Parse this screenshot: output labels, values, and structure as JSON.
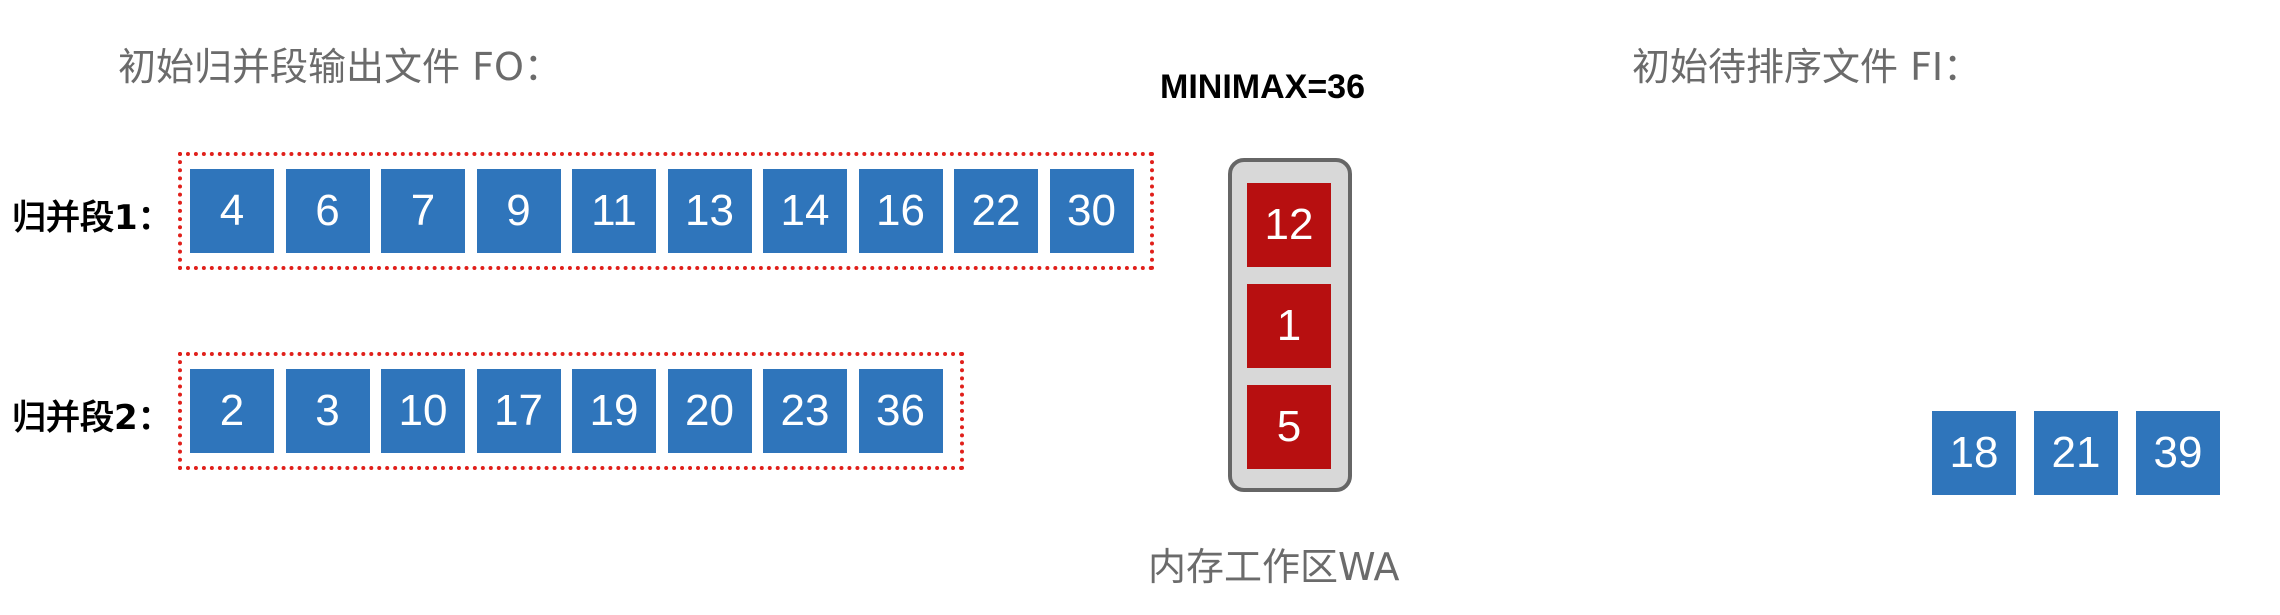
{
  "headings": {
    "output_file": "初始归并段输出文件 FO：",
    "input_file": "初始待排序文件 FI：",
    "minimax": "MINIMAX=36",
    "work_area": "内存工作区WA"
  },
  "runs": [
    {
      "label": "归并段1：",
      "values": [
        "4",
        "6",
        "7",
        "9",
        "11",
        "13",
        "14",
        "16",
        "22",
        "30"
      ]
    },
    {
      "label": "归并段2：",
      "values": [
        "2",
        "3",
        "10",
        "17",
        "19",
        "20",
        "23",
        "36"
      ]
    }
  ],
  "work_area_values": [
    "12",
    "1",
    "5"
  ],
  "input_values": [
    "18",
    "21",
    "39"
  ],
  "colors": {
    "blue_cell": "#2f75bb",
    "red_cell": "#b70f10",
    "dotted_border": "#e0201b",
    "work_area_bg": "#d8d8d8"
  }
}
